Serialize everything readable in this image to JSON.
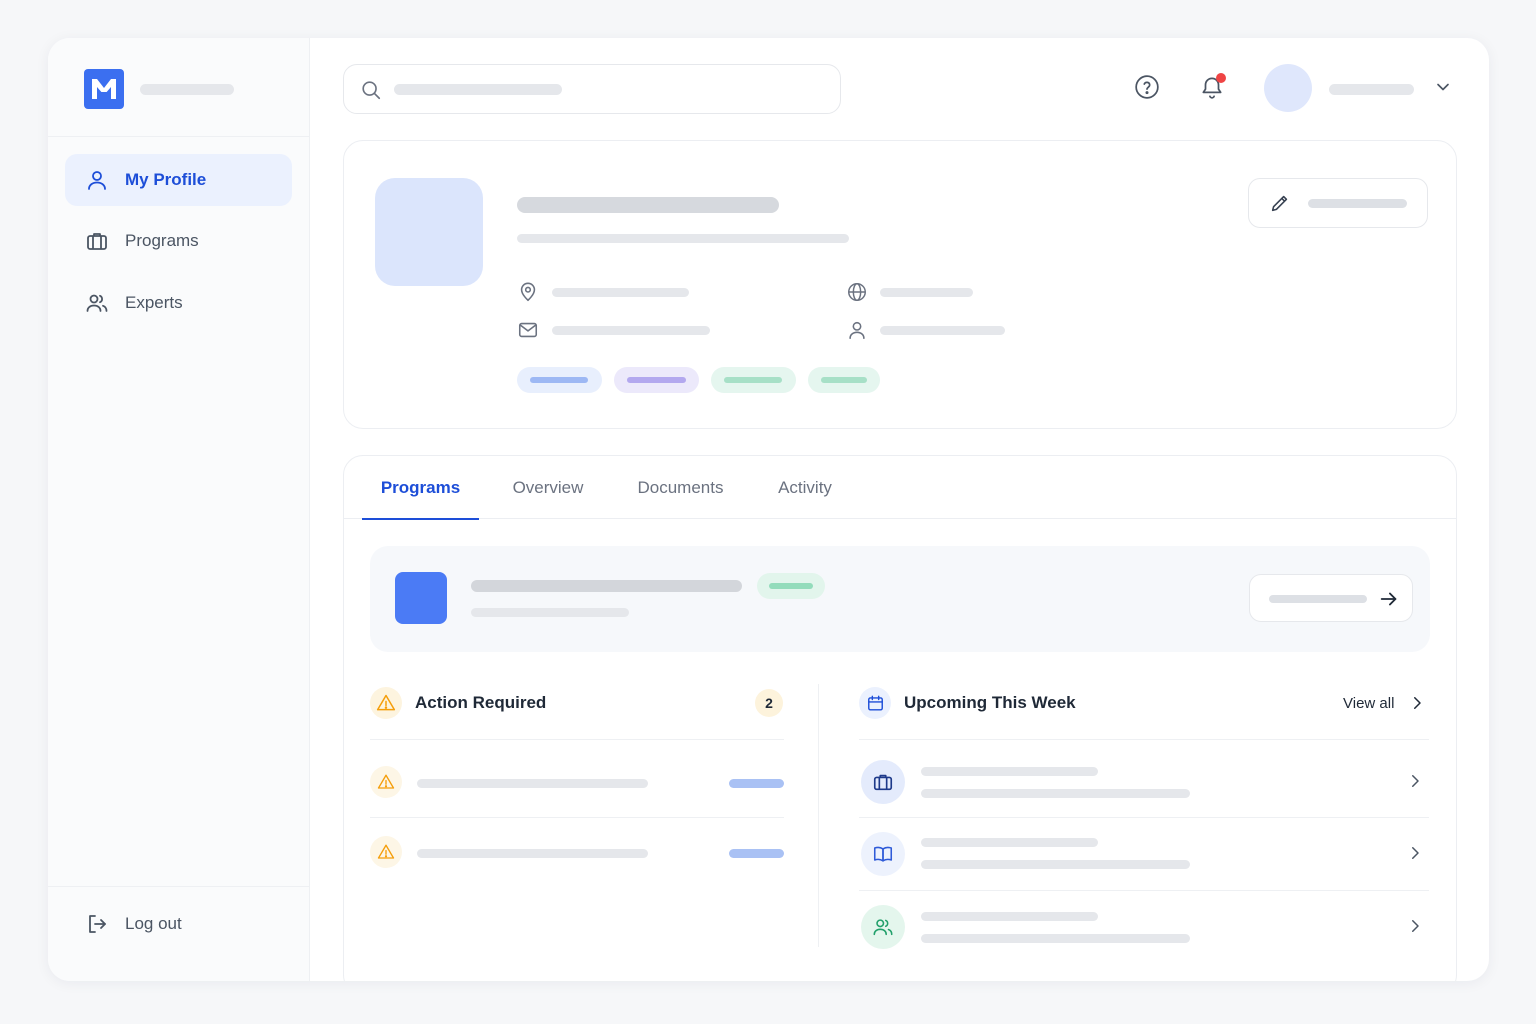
{
  "sidebar": {
    "items": [
      {
        "label": "My Profile",
        "icon": "user-icon",
        "active": true
      },
      {
        "label": "Programs",
        "icon": "briefcase-icon",
        "active": false
      },
      {
        "label": "Experts",
        "icon": "users-icon",
        "active": false
      }
    ],
    "logout_label": "Log out"
  },
  "tabs": [
    {
      "label": "Programs",
      "active": true
    },
    {
      "label": "Overview",
      "active": false
    },
    {
      "label": "Documents",
      "active": false
    },
    {
      "label": "Activity",
      "active": false
    }
  ],
  "action_required": {
    "title": "Action Required",
    "count": "2"
  },
  "upcoming": {
    "title": "Upcoming This Week",
    "view_all": "View all"
  },
  "colors": {
    "accent": "#1d4ed8",
    "brand": "#3b6ff0",
    "warning": "#f59e0b",
    "notification": "#ef4444",
    "success": "#22a06b"
  }
}
